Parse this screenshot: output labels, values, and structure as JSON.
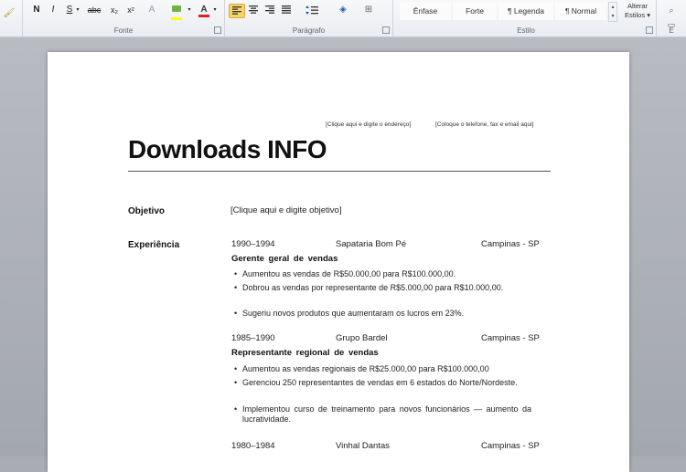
{
  "ribbon": {
    "font": {
      "label": "Fonte",
      "bold": "N",
      "italic": "I",
      "underline": "S",
      "strike": "abc",
      "subscript": "x₂",
      "superscript": "x²",
      "font_color_letter": "A"
    },
    "paragraph": {
      "label": "Parágrafo"
    },
    "styles": {
      "label": "Estilo",
      "items": [
        "Ênfase",
        "Forte",
        "¶ Legenda",
        "¶ Normal"
      ],
      "change_styles_line1": "Alterar",
      "change_styles_line2": "Estilos ▾",
      "edit_label": "E"
    }
  },
  "document": {
    "address_placeholder": "[Clique aqui e digite o endereço]",
    "phone_placeholder": "[Coloque o telefone, fax e email aqui]",
    "name": "Downloads INFO",
    "objective_label": "Objetivo",
    "objective_text_pre": "[Clique ",
    "objective_text_bold": "aqui",
    "objective_text_post": " e digite objetivo]",
    "experience_label": "Experiência",
    "jobs": [
      {
        "years": "1990–1994",
        "company": "Sapataria Bom Pé",
        "location": "Campinas - SP",
        "role": "Gerente geral de vendas",
        "bullets": [
          "Aumentou as vendas de R$50.000,00 para R$100.000,00.",
          "Dobrou as vendas por representante de R$5.000,00 para R$10.000,00.",
          "Sugeriu novos produtos que aumentaram os lucros em 23%."
        ]
      },
      {
        "years": "1985–1990",
        "company": "Grupo Bardel",
        "location": "Campinas - SP",
        "role": "Representante regional de vendas",
        "bullets": [
          "Aumentou as vendas regionais de R$25.000,00 para R$100.000,00",
          "Gerenciou 250 representantes de vendas em 6 estados do Norte/Nordeste.",
          "Implementou curso de treinamento para novos funcionários — aumento da lucratividade."
        ]
      },
      {
        "years": "1980–1984",
        "company": "Vinhal Dantas",
        "location": "Campinas - SP"
      }
    ]
  }
}
